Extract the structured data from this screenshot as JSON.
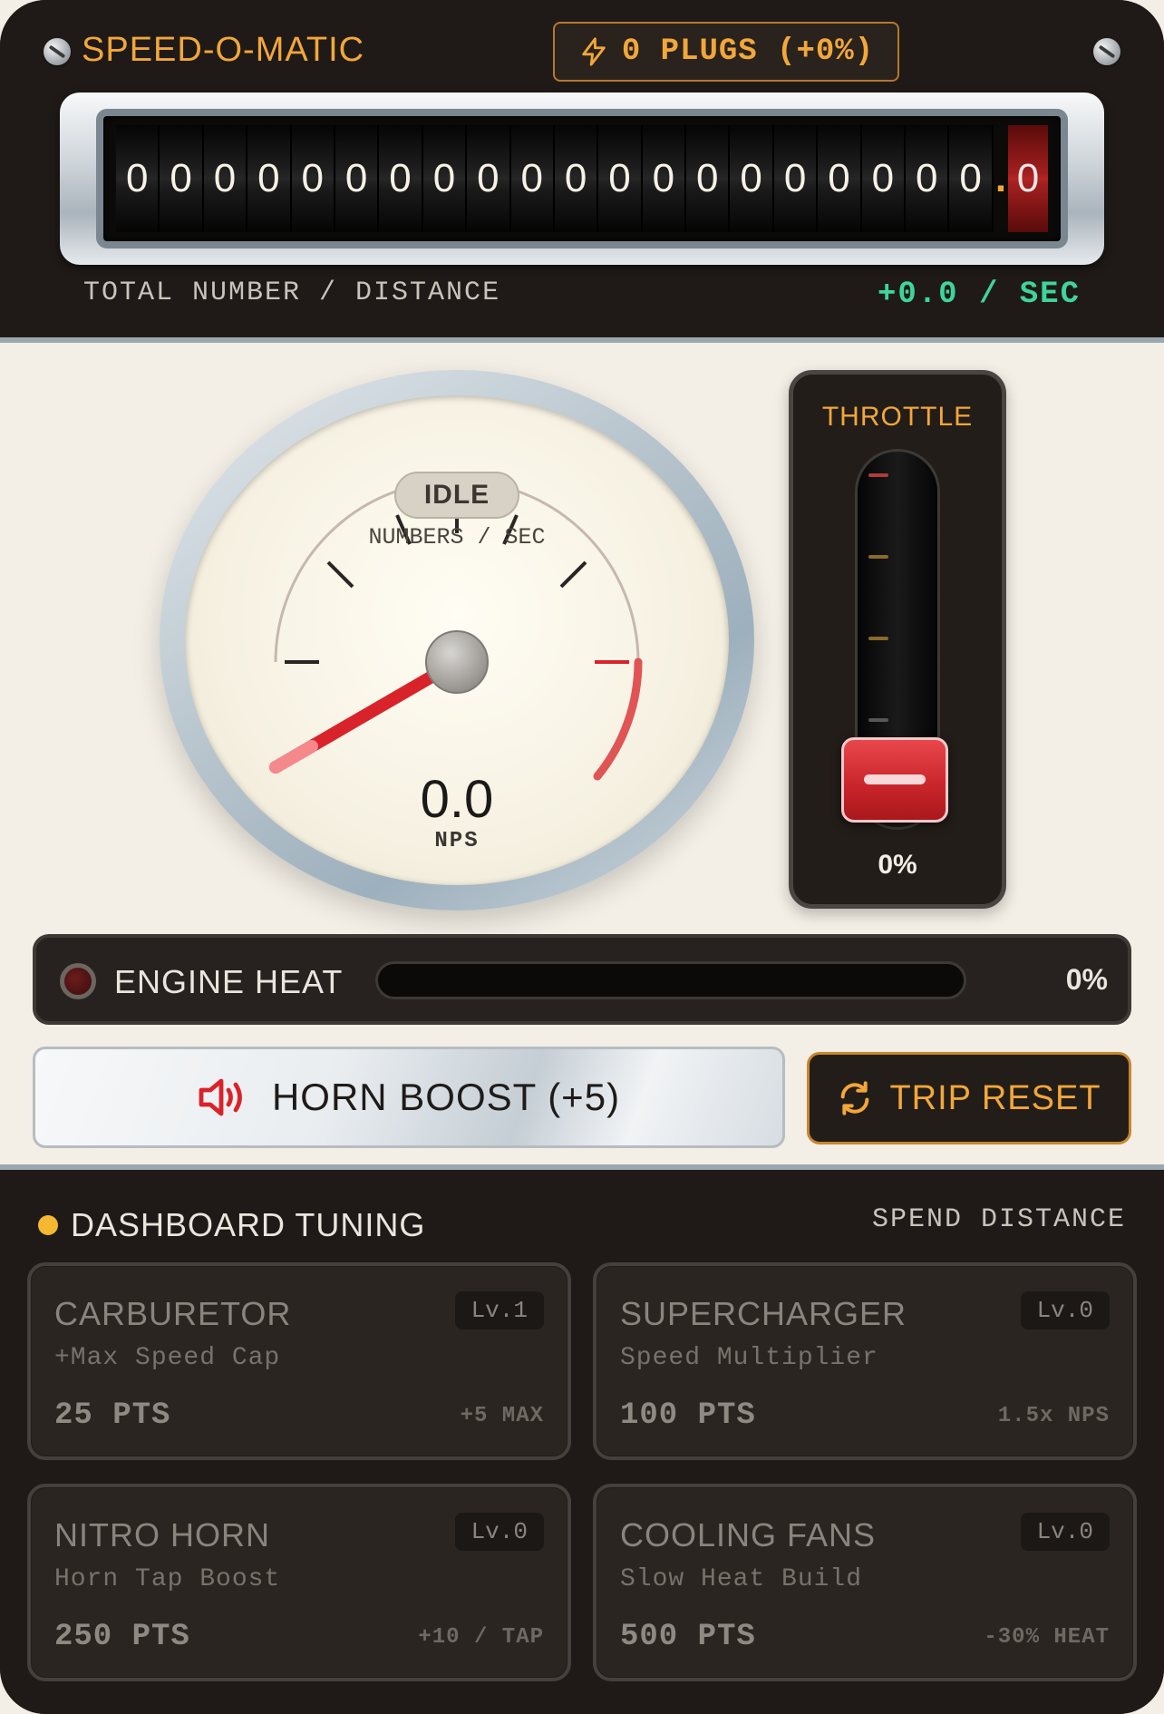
{
  "header": {
    "brand": "SPEED-O-MATIC",
    "plugs_label": "0 PLUGS (+0%)",
    "odometer_digits": [
      "0",
      "0",
      "0",
      "0",
      "0",
      "0",
      "0",
      "0",
      "0",
      "0",
      "0",
      "0",
      "0",
      "0",
      "0",
      "0",
      "0",
      "0",
      "0",
      "0"
    ],
    "odometer_decimal": "0",
    "odometer_label": "TOTAL NUMBER / DISTANCE",
    "rate_label": "+0.0 / SEC"
  },
  "gauge": {
    "status": "IDLE",
    "unit_top": "NUMBERS / SEC",
    "value": "0.0",
    "unit": "NPS"
  },
  "throttle": {
    "title": "THROTTLE",
    "percent": "0%",
    "level": 0
  },
  "heat": {
    "label": "ENGINE HEAT",
    "percent": "0%",
    "level": 0
  },
  "buttons": {
    "horn": "HORN BOOST (+5)",
    "reset": "TRIP RESET"
  },
  "tuning": {
    "title": "DASHBOARD TUNING",
    "spend": "SPEND DISTANCE",
    "cards": [
      {
        "name": "CARBURETOR",
        "level": "Lv.1",
        "desc": "+Max Speed Cap",
        "cost": "25 PTS",
        "effect": "+5 MAX"
      },
      {
        "name": "SUPERCHARGER",
        "level": "Lv.0",
        "desc": "Speed Multiplier",
        "cost": "100 PTS",
        "effect": "1.5x NPS"
      },
      {
        "name": "NITRO HORN",
        "level": "Lv.0",
        "desc": "Horn Tap Boost",
        "cost": "250 PTS",
        "effect": "+10 / TAP"
      },
      {
        "name": "COOLING FANS",
        "level": "Lv.0",
        "desc": "Slow Heat Build",
        "cost": "500 PTS",
        "effect": "-30% HEAT"
      }
    ]
  },
  "colors": {
    "accent": "#f2a73a",
    "rate_green": "#3fd49a",
    "needle_red": "#d9232a"
  }
}
